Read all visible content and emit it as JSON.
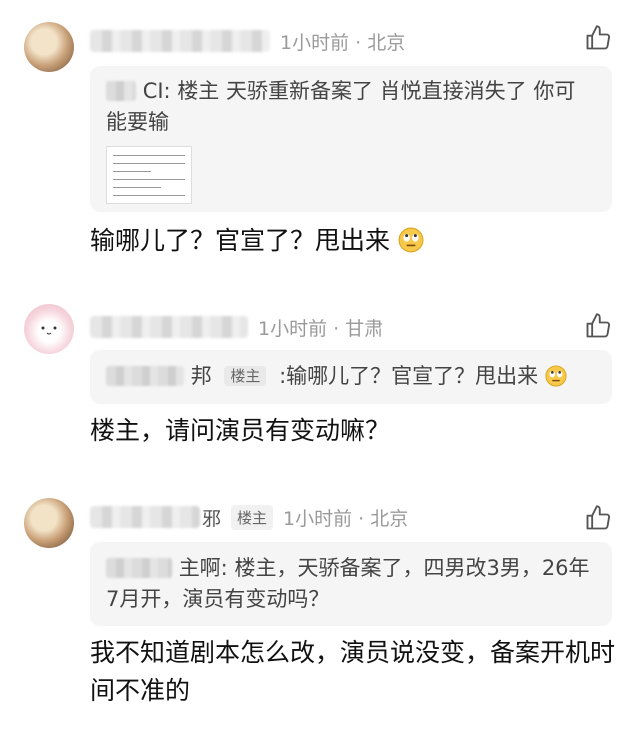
{
  "comments": [
    {
      "name_tail": "",
      "badge": "",
      "time": "1小时前",
      "location": "北京",
      "quote": {
        "author_tail": "CI:",
        "badge": "",
        "text": "楼主 天骄重新备案了 肖悦直接消失了 你可能要输"
      },
      "text": "输哪儿了？官宣了？甩出来"
    },
    {
      "name_tail": "",
      "badge": "",
      "time": "1小时前",
      "location": "甘肃",
      "quote": {
        "author_tail": "邦",
        "badge": "楼主",
        "text": ":输哪儿了？官宣了？甩出来"
      },
      "text": "楼主，请问演员有变动嘛？"
    },
    {
      "name_tail": "邪",
      "badge": "楼主",
      "time": "1小时前",
      "location": "北京",
      "quote": {
        "author_tail": "主啊:",
        "badge": "",
        "text": "楼主，天骄备案了，四男改3男，26年7月开，演员有变动吗？"
      },
      "text": "我不知道剧本怎么改，演员说没变，备案开机时间不准的"
    }
  ],
  "icons": {
    "like": "thumbs-up-icon",
    "emoji": "rolling-eyes-emoji-icon"
  },
  "colors": {
    "meta": "#9a9a9a",
    "quote_bg": "#f5f5f5",
    "text": "#111111"
  }
}
